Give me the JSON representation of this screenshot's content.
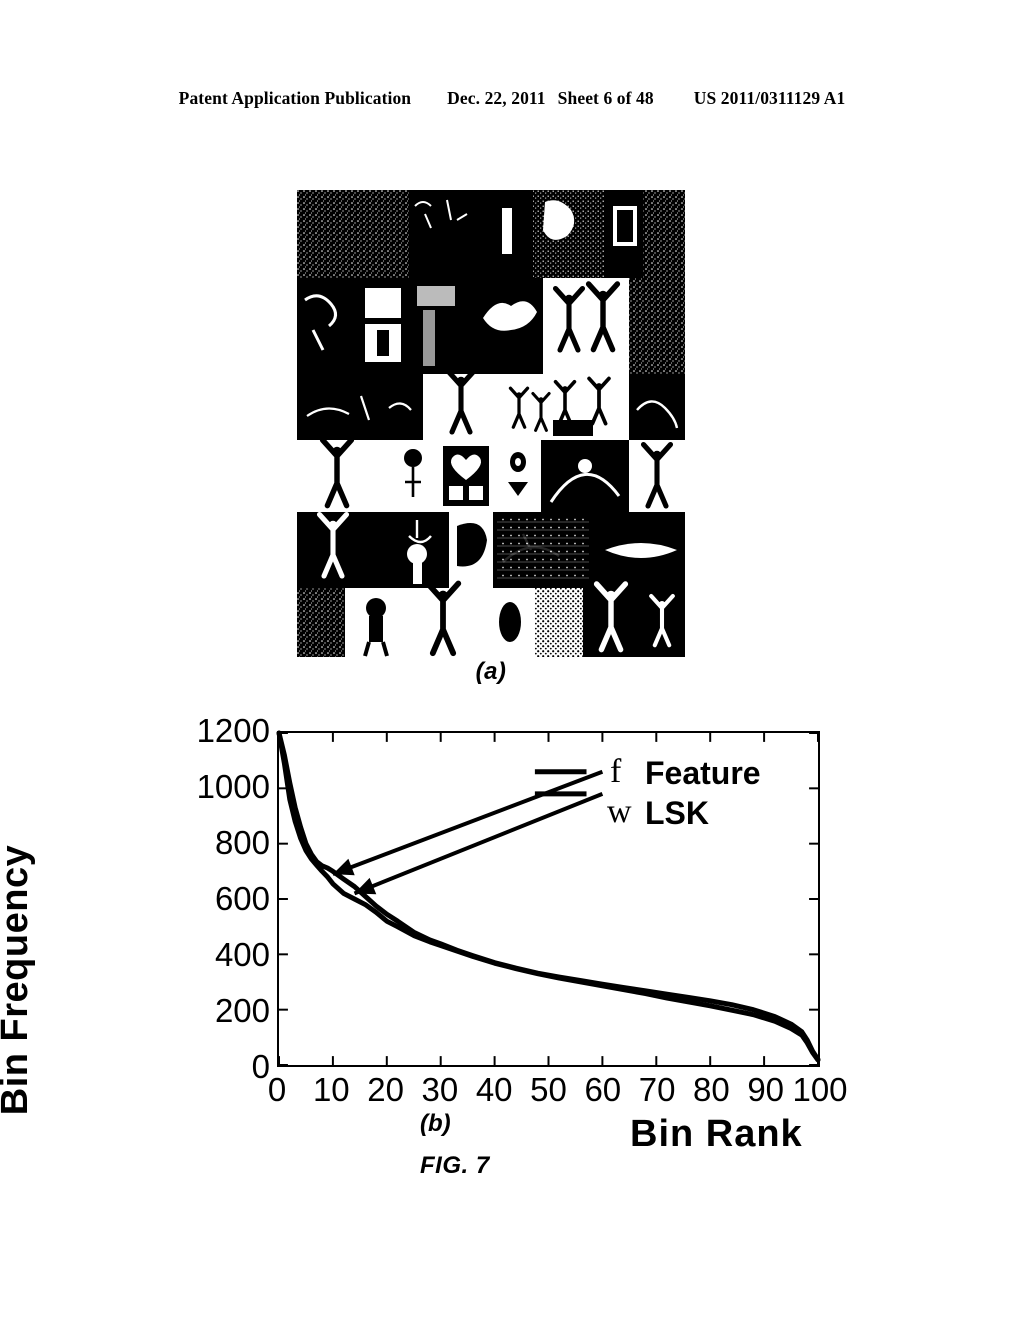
{
  "header": {
    "publication": "Patent Application Publication",
    "date": "Dec. 22, 2011",
    "sheet": "Sheet 6 of 48",
    "publication_number": "US 2011/0311129 A1"
  },
  "figure": {
    "caption": "FIG. 7",
    "panel_a_label": "(a)",
    "panel_b_label": "(b)",
    "panel_a_description": "Collage of high-contrast black-and-white training images of people with raised arms"
  },
  "chart_data": {
    "type": "line",
    "title": "",
    "xlabel": "Bin Rank",
    "ylabel": "Bin Frequency",
    "xlim": [
      0,
      100
    ],
    "ylim": [
      0,
      1200
    ],
    "xticks": [
      0,
      10,
      20,
      30,
      40,
      50,
      60,
      70,
      80,
      90,
      100
    ],
    "yticks": [
      0,
      200,
      400,
      600,
      800,
      1000,
      1200
    ],
    "grid": false,
    "legend_position": "upper right",
    "legend": [
      {
        "symbol": "f",
        "label": "Feature"
      },
      {
        "symbol": "w",
        "label": "LSK"
      }
    ],
    "x": [
      0,
      1,
      2,
      3,
      4,
      5,
      6,
      7,
      8,
      9,
      10,
      12,
      14,
      16,
      18,
      20,
      22,
      25,
      28,
      30,
      33,
      36,
      40,
      44,
      48,
      52,
      56,
      60,
      64,
      68,
      72,
      76,
      80,
      84,
      88,
      92,
      95,
      97,
      98,
      99,
      100
    ],
    "series": [
      {
        "name": "f Feature",
        "symbol": "f",
        "color": "#000000",
        "values": [
          1200,
          1120,
          1020,
          930,
          860,
          800,
          762,
          735,
          720,
          712,
          700,
          672,
          645,
          610,
          575,
          545,
          520,
          480,
          452,
          438,
          415,
          395,
          370,
          350,
          332,
          318,
          305,
          292,
          280,
          268,
          256,
          244,
          232,
          218,
          200,
          175,
          148,
          120,
          90,
          50,
          20
        ]
      },
      {
        "name": "w LSK",
        "symbol": "w",
        "color": "#000000",
        "values": [
          1200,
          1090,
          960,
          880,
          820,
          775,
          745,
          722,
          700,
          680,
          655,
          620,
          600,
          580,
          552,
          520,
          500,
          468,
          445,
          432,
          412,
          392,
          368,
          348,
          330,
          314,
          300,
          286,
          272,
          258,
          242,
          228,
          214,
          198,
          182,
          158,
          132,
          108,
          80,
          45,
          18
        ]
      }
    ],
    "annotations": [
      {
        "name": "arrow-to-feature-curve",
        "label": "f Feature",
        "from_x": 60,
        "from_y": 1060,
        "to_x": 10,
        "to_y": 690
      },
      {
        "name": "arrow-to-lsk-curve",
        "label": "w LSK",
        "from_x": 60,
        "from_y": 980,
        "to_x": 14,
        "to_y": 620
      }
    ]
  }
}
